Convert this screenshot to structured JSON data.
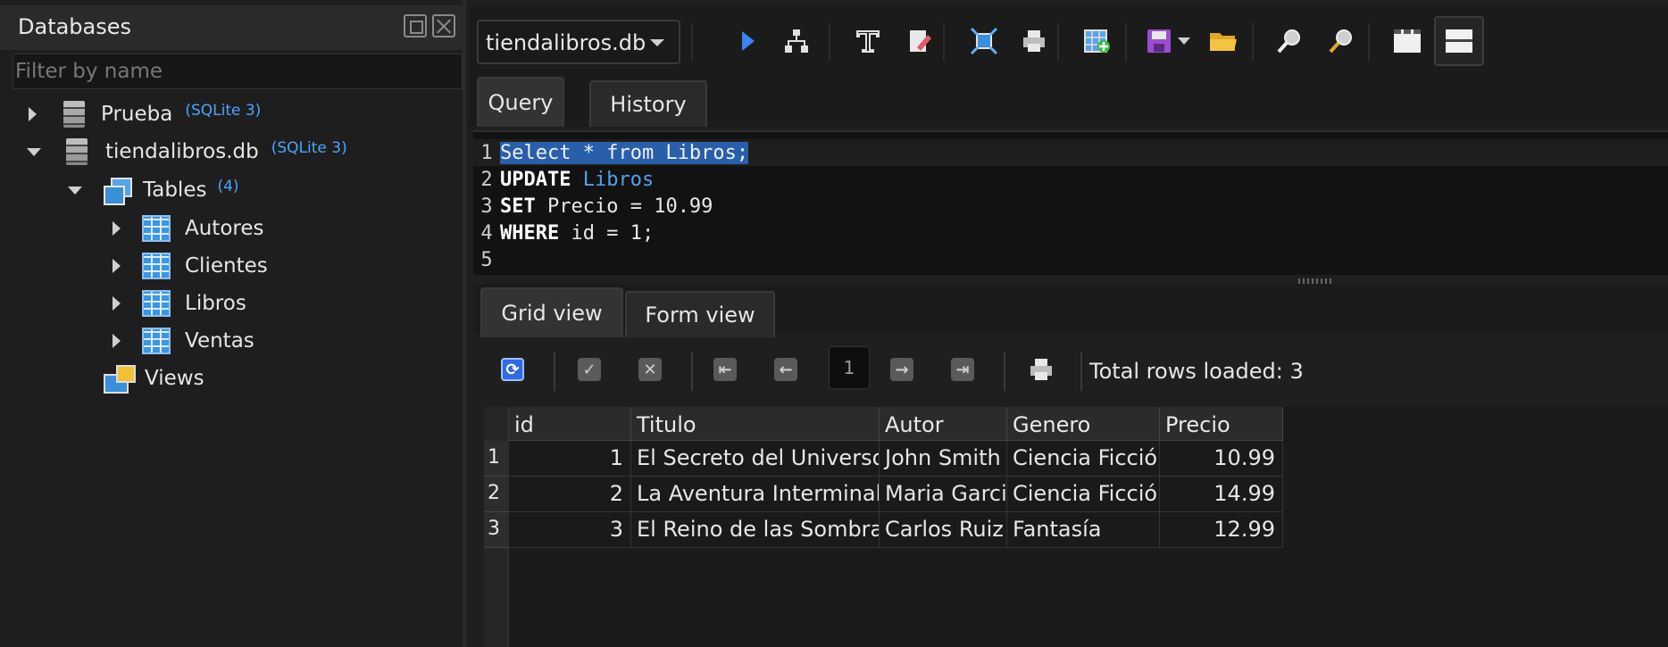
{
  "left_panel": {
    "title": "Databases",
    "filter_placeholder": "Filter by name",
    "tree": {
      "db1": {
        "name": "Prueba",
        "tag": "(SQLite 3)"
      },
      "db2": {
        "name": "tiendalibros.db",
        "tag": "(SQLite 3)"
      },
      "tables": {
        "label": "Tables",
        "count": "(4)"
      },
      "table_items": [
        "Autores",
        "Clientes",
        "Libros",
        "Ventas"
      ],
      "views": "Views"
    }
  },
  "toolbar": {
    "selected_db": "tiendalibros.db",
    "icons": [
      "run-icon",
      "execute-explain-icon",
      "format-text-icon",
      "clear-icon",
      "fit-icon",
      "print-icon",
      "add-icon",
      "save-icon",
      "open-folder-icon",
      "zoom-in-icon",
      "zoom-out-icon",
      "layout-a-icon",
      "layout-b-icon"
    ]
  },
  "query_tabs": [
    "Query",
    "History"
  ],
  "editor": {
    "line_numbers": [
      "1",
      "2",
      "3",
      "4",
      "5"
    ],
    "lines": [
      {
        "text": "Select * from Libros;"
      },
      {
        "kw": "UPDATE",
        "rest": " Libros"
      },
      {
        "kw": "SET",
        "rest": " Precio = 10.99"
      },
      {
        "kw": "WHERE",
        "rest": " id = 1;"
      }
    ]
  },
  "results": {
    "tabs": [
      "Grid view",
      "Form view"
    ],
    "page_number": "1",
    "total_rows": "Total rows loaded: 3",
    "columns": [
      "id",
      "Titulo",
      "Autor",
      "Genero",
      "Precio"
    ],
    "row_numbers": [
      "1",
      "2",
      "3"
    ],
    "rows": [
      [
        "1",
        "El Secreto del Universo",
        "John Smith",
        "Ciencia Ficción",
        "10.99"
      ],
      [
        "2",
        "La Aventura Interminable",
        "Maria Garcia",
        "Ciencia Ficción",
        "14.99"
      ],
      [
        "3",
        "El Reino de las Sombras",
        "Carlos Ruiz",
        "Fantasía",
        "12.99"
      ]
    ]
  },
  "colors": {
    "accent": "#3b82f6",
    "selection": "#2b5ea8",
    "tag": "#4ea3ff",
    "background": "#1f1f1f"
  }
}
